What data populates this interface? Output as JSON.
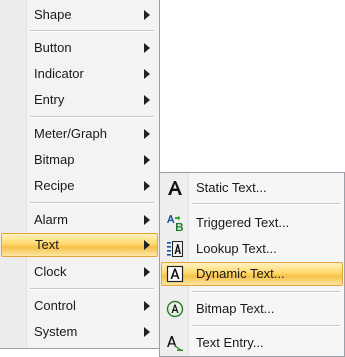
{
  "main_menu": {
    "items": [
      {
        "label": "Shape"
      },
      {
        "label": "Button"
      },
      {
        "label": "Indicator"
      },
      {
        "label": "Entry"
      },
      {
        "label": "Meter/Graph"
      },
      {
        "label": "Bitmap"
      },
      {
        "label": "Recipe"
      },
      {
        "label": "Alarm"
      },
      {
        "label": "Text"
      },
      {
        "label": "Clock"
      },
      {
        "label": "Control"
      },
      {
        "label": "System"
      }
    ],
    "selected": "Text"
  },
  "text_submenu": {
    "items": [
      {
        "label": "Static Text...",
        "icon": "static-text-icon"
      },
      {
        "label": "Triggered Text...",
        "icon": "triggered-text-icon"
      },
      {
        "label": "Lookup Text...",
        "icon": "lookup-text-icon"
      },
      {
        "label": "Dynamic Text...",
        "icon": "dynamic-text-icon"
      },
      {
        "label": "Bitmap Text...",
        "icon": "bitmap-text-icon"
      },
      {
        "label": "Text Entry...",
        "icon": "text-entry-icon"
      }
    ],
    "selected": "Dynamic Text..."
  },
  "colors": {
    "highlight_border": "#e7a33a",
    "highlight_fill": "#ffd86b",
    "menu_background": "#f3f3f3"
  }
}
